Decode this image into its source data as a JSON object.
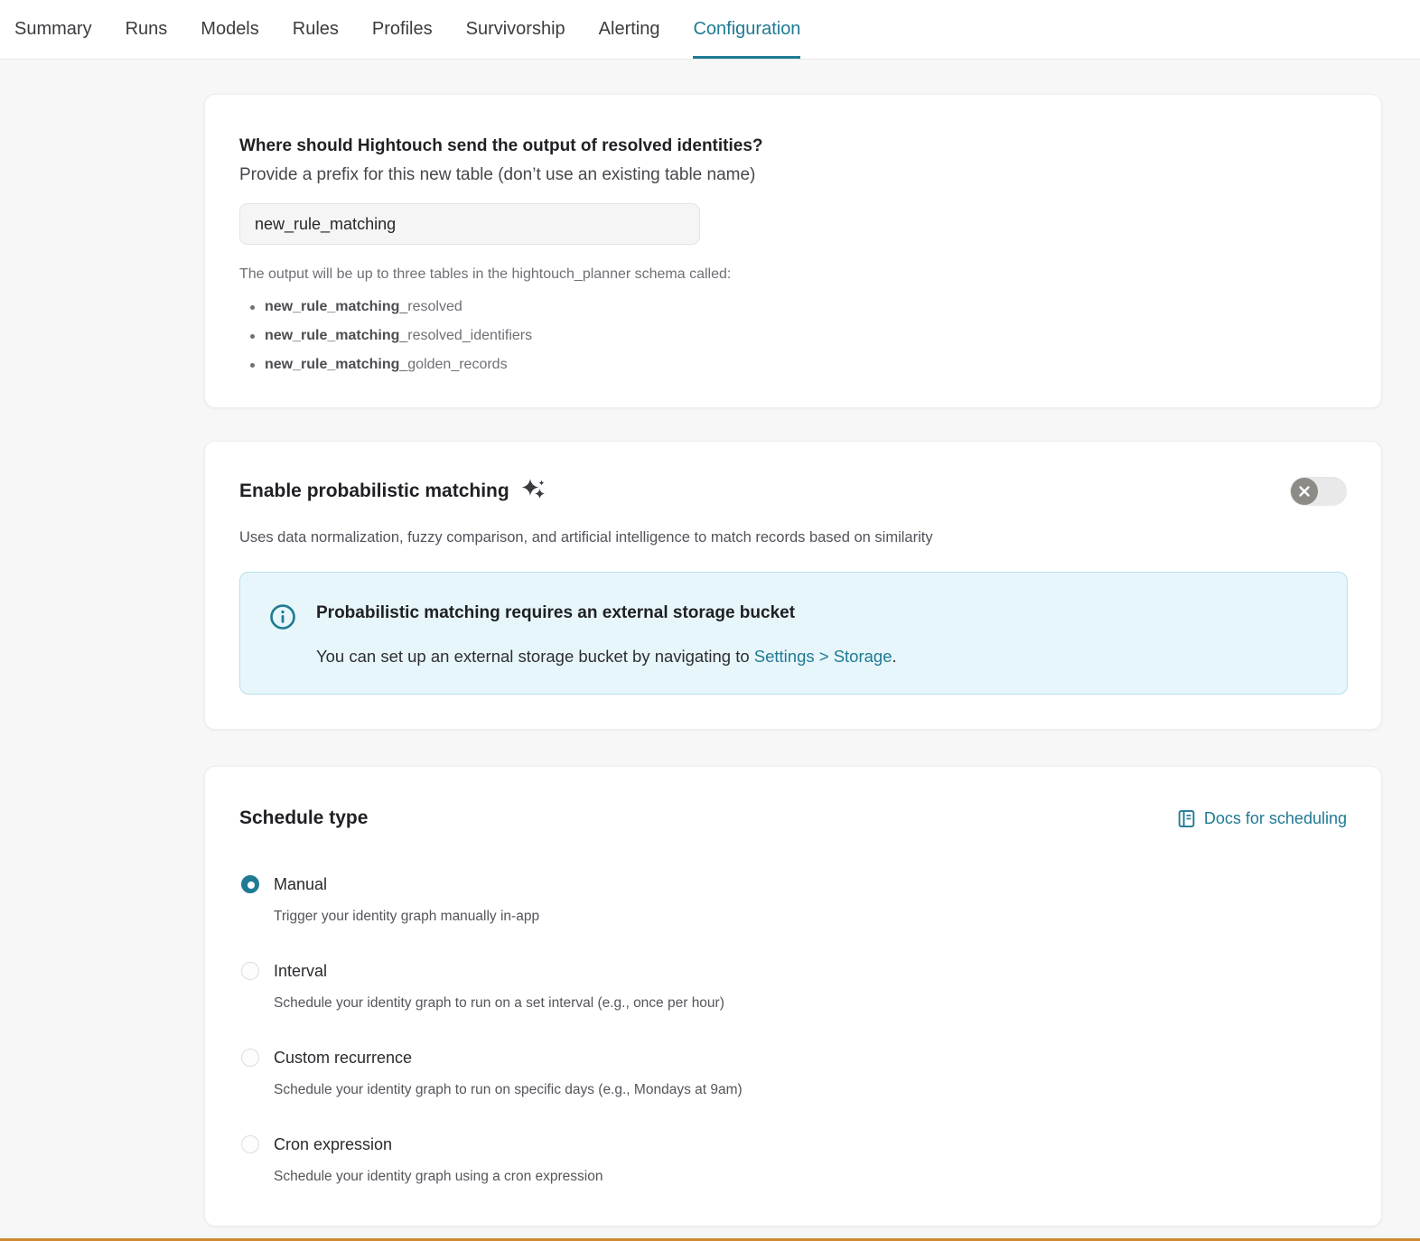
{
  "nav": {
    "tabs": [
      {
        "label": "Summary",
        "active": false
      },
      {
        "label": "Runs",
        "active": false
      },
      {
        "label": "Models",
        "active": false
      },
      {
        "label": "Rules",
        "active": false
      },
      {
        "label": "Profiles",
        "active": false
      },
      {
        "label": "Survivorship",
        "active": false
      },
      {
        "label": "Alerting",
        "active": false
      },
      {
        "label": "Configuration",
        "active": true
      }
    ]
  },
  "output_card": {
    "title": "Where should Hightouch send the output of resolved identities?",
    "subtitle": "Provide a prefix for this new table (don’t use an existing table name)",
    "prefix_input": {
      "value": "new_rule_matching"
    },
    "help_text": "The output will be up to three tables in the hightouch_planner schema called:",
    "tables": [
      {
        "prefix": "new_rule_matching",
        "suffix": "_resolved"
      },
      {
        "prefix": "new_rule_matching",
        "suffix": "_resolved_identifiers"
      },
      {
        "prefix": "new_rule_matching",
        "suffix": "_golden_records"
      }
    ]
  },
  "probabilistic_card": {
    "title": "Enable probabilistic matching",
    "toggle_state": "off",
    "description": "Uses data normalization, fuzzy comparison, and artificial intelligence to match records based on similarity",
    "alert": {
      "title": "Probabilistic matching requires an external storage bucket",
      "body_prefix": "You can set up an external storage bucket by navigating to ",
      "link": "Settings > Storage",
      "body_suffix": "."
    }
  },
  "schedule_card": {
    "title": "Schedule type",
    "docs_link": "Docs for scheduling",
    "options": [
      {
        "label": "Manual",
        "description": "Trigger your identity graph manually in-app",
        "selected": true
      },
      {
        "label": "Interval",
        "description": "Schedule your identity graph to run on a set interval (e.g., once per hour)",
        "selected": false
      },
      {
        "label": "Custom recurrence",
        "description": "Schedule your identity graph to run on specific days (e.g., Mondays at 9am)",
        "selected": false
      },
      {
        "label": "Cron expression",
        "description": "Schedule your identity graph using a cron expression",
        "selected": false
      }
    ]
  },
  "colors": {
    "accent_teal": "#207a94",
    "alert_bg": "#e7f6fa",
    "alert_border": "#b7e1ec",
    "toggle_knob": "#8c8b86",
    "bottom_bar": "#cf8a33"
  }
}
